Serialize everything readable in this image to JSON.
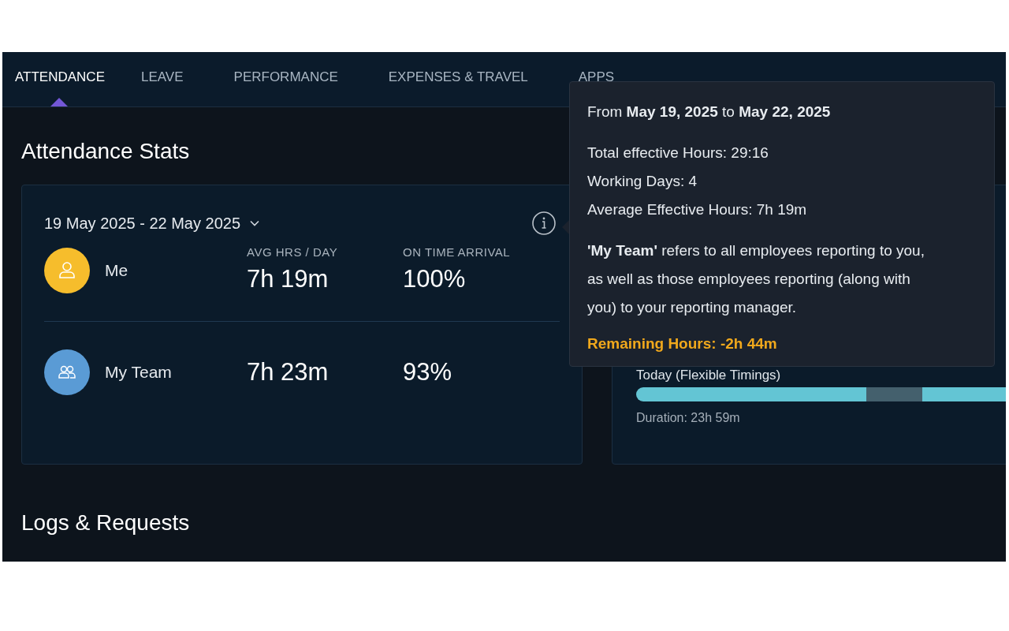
{
  "tabs": [
    {
      "label": "ATTENDANCE",
      "selected": true
    },
    {
      "label": "LEAVE",
      "selected": false
    },
    {
      "label": "PERFORMANCE",
      "selected": false
    },
    {
      "label": "EXPENSES & TRAVEL",
      "selected": false
    },
    {
      "label": "APPS",
      "selected": false
    }
  ],
  "stats": {
    "title": "Attendance Stats",
    "date_range": "19 May 2025 - 22 May 2025",
    "columns": [
      "AVG HRS / DAY",
      "ON TIME ARRIVAL"
    ],
    "rows": [
      {
        "kind": "me",
        "name": "Me",
        "color": "#f6bd2c",
        "avg": "7h 19m",
        "on_time": "100%"
      },
      {
        "kind": "team",
        "name": "My Team",
        "color": "#5a9bd5",
        "avg": "7h 23m",
        "on_time": "93%"
      }
    ]
  },
  "timings": {
    "label": "Today (Flexible Timings)",
    "duration": "Duration: 23h 59m"
  },
  "tooltip": {
    "range": "From **May 19, 2025** to **May 22, 2025**",
    "lines": [
      "Total effective Hours: 29:16",
      "Working Days: 4",
      "Average Effective Hours: 7h 19m"
    ],
    "note": "**'My Team'** refers to all employees reporting to you, as well as those employees reporting (along with you) to your reporting manager.",
    "remaining": "Remaining Hours: -2h 44m"
  },
  "logs": {
    "title": "Logs & Requests"
  }
}
